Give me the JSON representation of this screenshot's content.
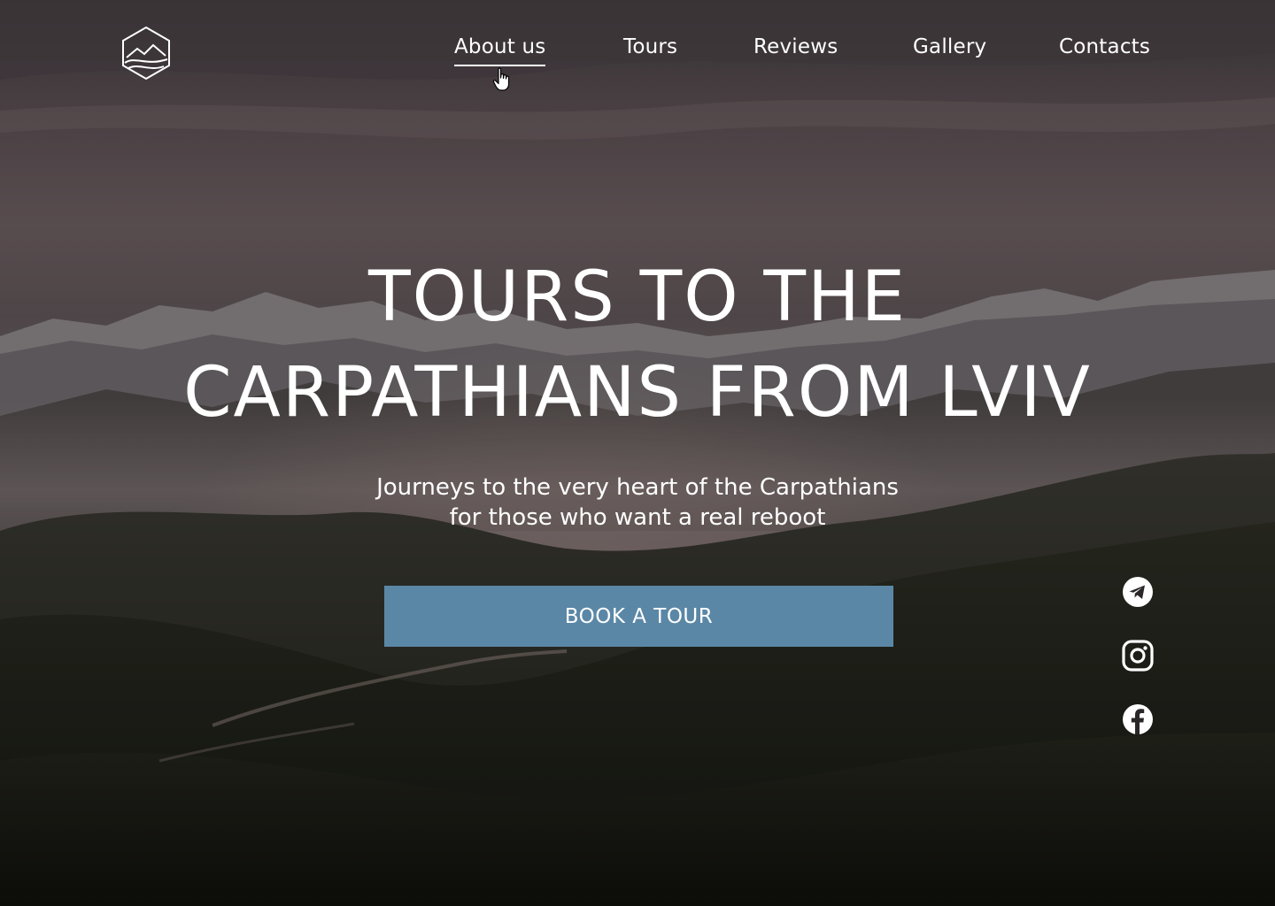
{
  "nav": {
    "items": [
      {
        "label": "About us",
        "active": true
      },
      {
        "label": "Tours",
        "active": false
      },
      {
        "label": "Reviews",
        "active": false
      },
      {
        "label": "Gallery",
        "active": false
      },
      {
        "label": "Contacts",
        "active": false
      }
    ]
  },
  "hero": {
    "title_line1": "TOURS TO THE",
    "title_line2": "CARPATHIANS FROM LVIV",
    "subtitle_line1": "Journeys to the very heart of the Carpathians",
    "subtitle_line2": "for those who want a real reboot",
    "cta_label": "BOOK A TOUR"
  },
  "social": [
    {
      "icon": "telegram-icon"
    },
    {
      "icon": "instagram-icon"
    },
    {
      "icon": "facebook-icon"
    }
  ],
  "colors": {
    "cta": "#5b87a6",
    "text": "#ffffff"
  }
}
